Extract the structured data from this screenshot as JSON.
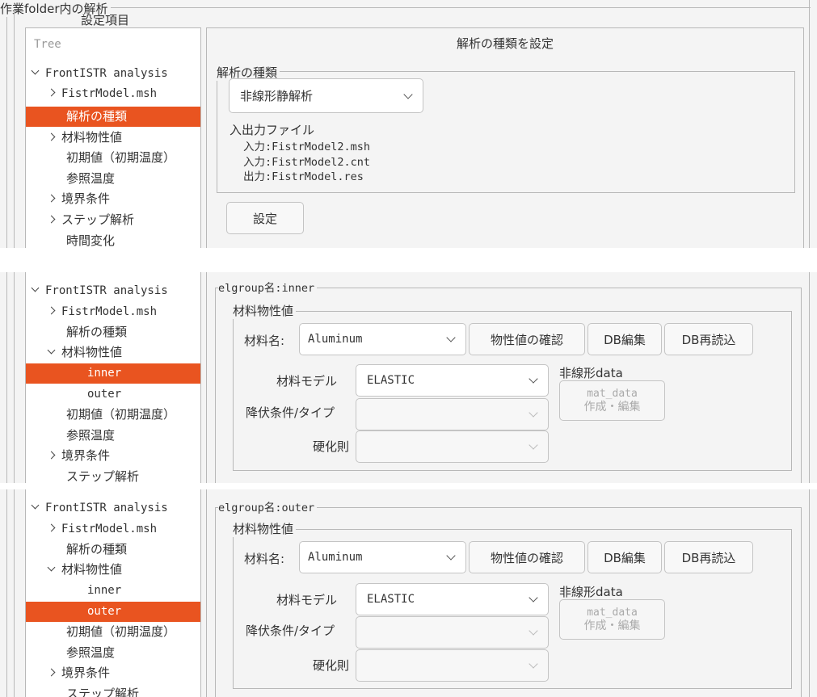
{
  "p1": {
    "frame_title": "作業folder内の解析",
    "side_title": "設定項目",
    "tree_header": "Tree",
    "tree_items": [
      "FrontISTR analysis",
      "FistrModel.msh",
      "解析の種類",
      "材料物性値",
      "初期値（初期温度）",
      "参照温度",
      "境界条件",
      "ステップ解析",
      "時間変化"
    ],
    "main_title": "解析の種類を設定",
    "group_label": "解析の種類",
    "analysis_type": "非線形静解析",
    "io_title": "入出力ファイル",
    "io_lines": [
      "入力:FistrModel2.msh",
      "入力:FistrModel2.cnt",
      "出力:FistrModel.res"
    ],
    "set_button": "設定"
  },
  "p2": {
    "tree_items": [
      "FrontISTR analysis",
      "FistrModel.msh",
      "解析の種類",
      "材料物性値",
      "inner",
      "outer",
      "初期値（初期温度）",
      "参照温度",
      "境界条件",
      "ステップ解析"
    ],
    "elgroup_label": "elgroup名:inner",
    "inner_label": "材料物性値",
    "material_label": "材料名:",
    "material_value": "Aluminum",
    "confirm_button": "物性値の確認",
    "db_edit_button": "DB編集",
    "db_reload_button": "DB再読込",
    "model_label": "材料モデル",
    "model_value": "ELASTIC",
    "yield_label": "降伏条件/タイプ",
    "hardening_label": "硬化則",
    "nonlinear_label": "非線形data",
    "mat_btn_line1": "mat_data",
    "mat_btn_line2": "作成・編集"
  },
  "p3": {
    "tree_items": [
      "FrontISTR analysis",
      "FistrModel.msh",
      "解析の種類",
      "材料物性値",
      "inner",
      "outer",
      "初期値（初期温度）",
      "参照温度",
      "境界条件",
      "ステップ解析"
    ],
    "elgroup_label": "elgroup名:outer",
    "inner_label": "材料物性値",
    "material_label": "材料名:",
    "material_value": "Aluminum",
    "confirm_button": "物性値の確認",
    "db_edit_button": "DB編集",
    "db_reload_button": "DB再読込",
    "model_label": "材料モデル",
    "model_value": "ELASTIC",
    "yield_label": "降伏条件/タイプ",
    "hardening_label": "硬化則",
    "nonlinear_label": "非線形data",
    "mat_btn_line1": "mat_data",
    "mat_btn_line2": "作成・編集"
  },
  "colors": {
    "selection": "#e95420",
    "background": "#f4f4f4",
    "border": "#b8b8b8"
  }
}
